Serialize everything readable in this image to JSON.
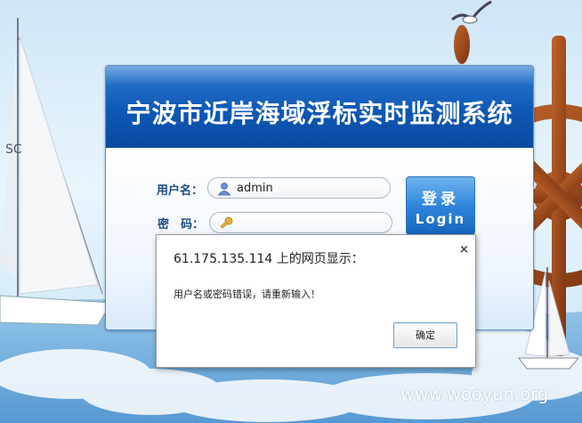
{
  "app": {
    "title": "宁波市近岸海域浮标实时监测系统"
  },
  "form": {
    "username_label": "用户名：",
    "username_value": "admin",
    "password_label": "密　码：",
    "password_value": ""
  },
  "login_button": {
    "zh": "登录",
    "en": "Login"
  },
  "dialog": {
    "title": "61.175.135.114 上的网页显示：",
    "close_glyph": "×",
    "message": "用户名或密码错误，请重新输入！",
    "ok_label": "确定"
  },
  "watermark": "www.wooyun.org",
  "colors": {
    "header_blue": "#0e58b5",
    "label_blue": "#1a4a82",
    "button_blue": "#2f86dd"
  },
  "icons": {
    "username": "user-icon",
    "password": "key-icon",
    "decor": [
      "seagull-icon",
      "ship-wheel-icon",
      "sailboat-icon",
      "cloud-icon"
    ]
  }
}
